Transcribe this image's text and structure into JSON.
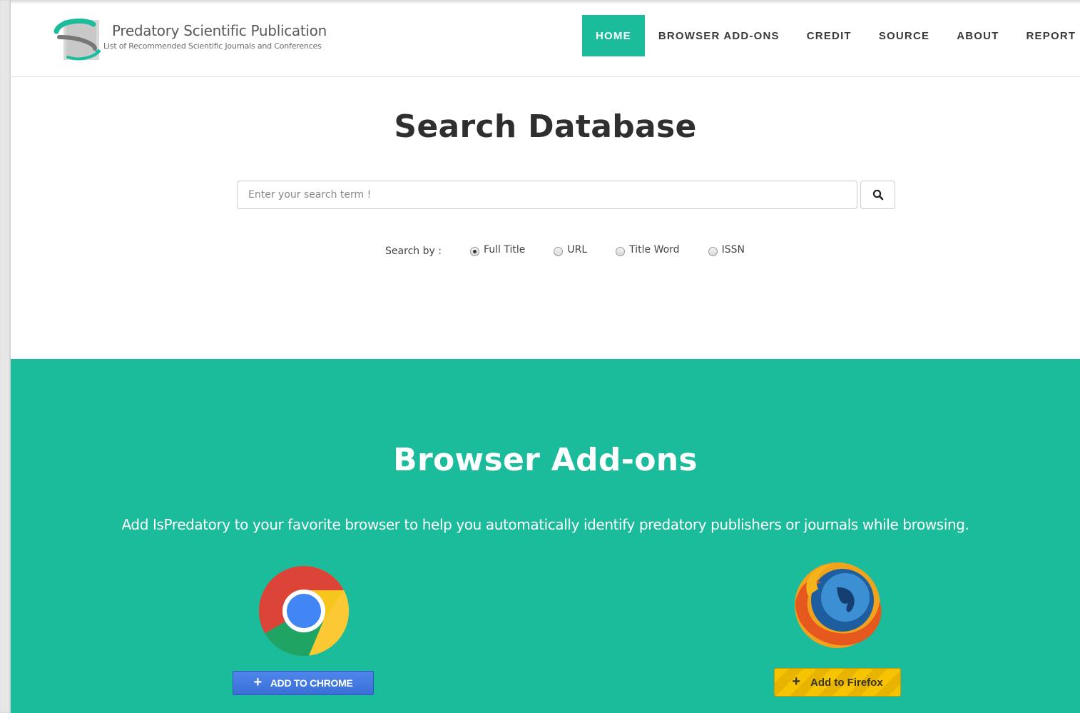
{
  "brand": {
    "title": "Predatory Scientific Publication",
    "subtitle": "List of Recommended Scientific Journals and Conferences"
  },
  "nav": [
    {
      "label": "HOME",
      "active": true
    },
    {
      "label": "BROWSER ADD-ONS",
      "active": false
    },
    {
      "label": "CREDIT",
      "active": false
    },
    {
      "label": "SOURCE",
      "active": false
    },
    {
      "label": "ABOUT",
      "active": false
    },
    {
      "label": "REPORT",
      "active": false
    }
  ],
  "search": {
    "title": "Search Database",
    "placeholder": "Enter your search term !",
    "value": "",
    "button_icon": "search-icon",
    "search_by_label": "Search by :",
    "options": [
      {
        "label": "Full Title",
        "checked": true
      },
      {
        "label": "URL",
        "checked": false
      },
      {
        "label": "Title Word",
        "checked": false
      },
      {
        "label": "ISSN",
        "checked": false
      }
    ]
  },
  "addons": {
    "title": "Browser Add-ons",
    "description": "Add IsPredatory to your favorite browser to help you automatically identify predatory publishers or journals while browsing.",
    "chrome_button": "ADD TO CHROME",
    "firefox_button": "Add to Firefox",
    "plus_glyph": "+"
  },
  "colors": {
    "accent": "#1bbc9b",
    "chrome_button": "#3f76df",
    "firefox_button": "#f2bf00"
  }
}
